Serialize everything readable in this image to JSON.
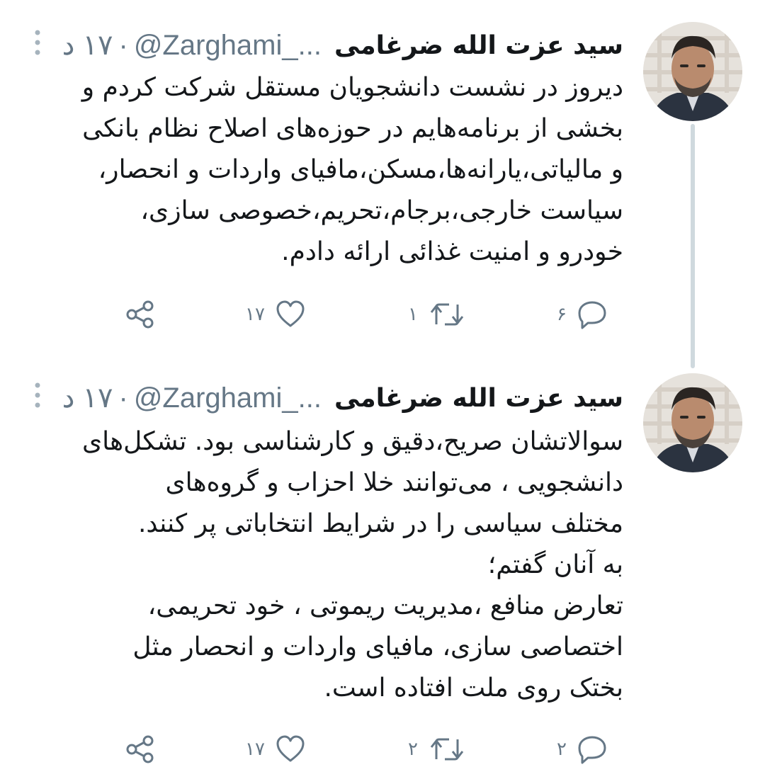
{
  "tweets": [
    {
      "author_name": "سید عزت الله ضرغامی",
      "handle": "@Zarghami_...",
      "separator": "·",
      "time": "۱۷ د",
      "text": "دیروز در نشست دانشجویان مستقل شرکت کردم و\nبخشی از برنامه‌هایم در حوزه‌های اصلاح نظام بانکی\nو مالیاتی،یارانه‌ها،مسکن،مافیای واردات و انحصار،\nسیاست خارجی،برجام،تحریم،خصوصی سازی،\nخودرو و امنیت غذائی ارائه دادم.",
      "reply_count": "۶",
      "retweet_count": "۱",
      "like_count": "۱۷"
    },
    {
      "author_name": "سید عزت الله ضرغامی",
      "handle": "@Zarghami_...",
      "separator": "·",
      "time": "۱۷ د",
      "text": "سوالاتشان صریح،دقیق و کارشناسی بود. تشکل‌های\nدانشجویی ، می‌توانند خلا احزاب و گروه‌های\nمختلف سیاسی را در شرایط انتخاباتی پر کنند.\nبه آنان گفتم؛\nتعارض منافع ،مدیریت ریموتی ، خود تحریمی،\nاختصاصی سازی، مافیای واردات و انحصار مثل\nبختک روی ملت افتاده است.",
      "reply_count": "۲",
      "retweet_count": "۲",
      "like_count": "۱۷"
    }
  ],
  "icons": {
    "reply": "reply-icon",
    "retweet": "retweet-icon",
    "like": "heart-icon",
    "share": "share-icon",
    "more": "more-vertical-icon"
  },
  "colors": {
    "text": "#14171a",
    "muted": "#657786",
    "thread_line": "#cfd9de"
  }
}
